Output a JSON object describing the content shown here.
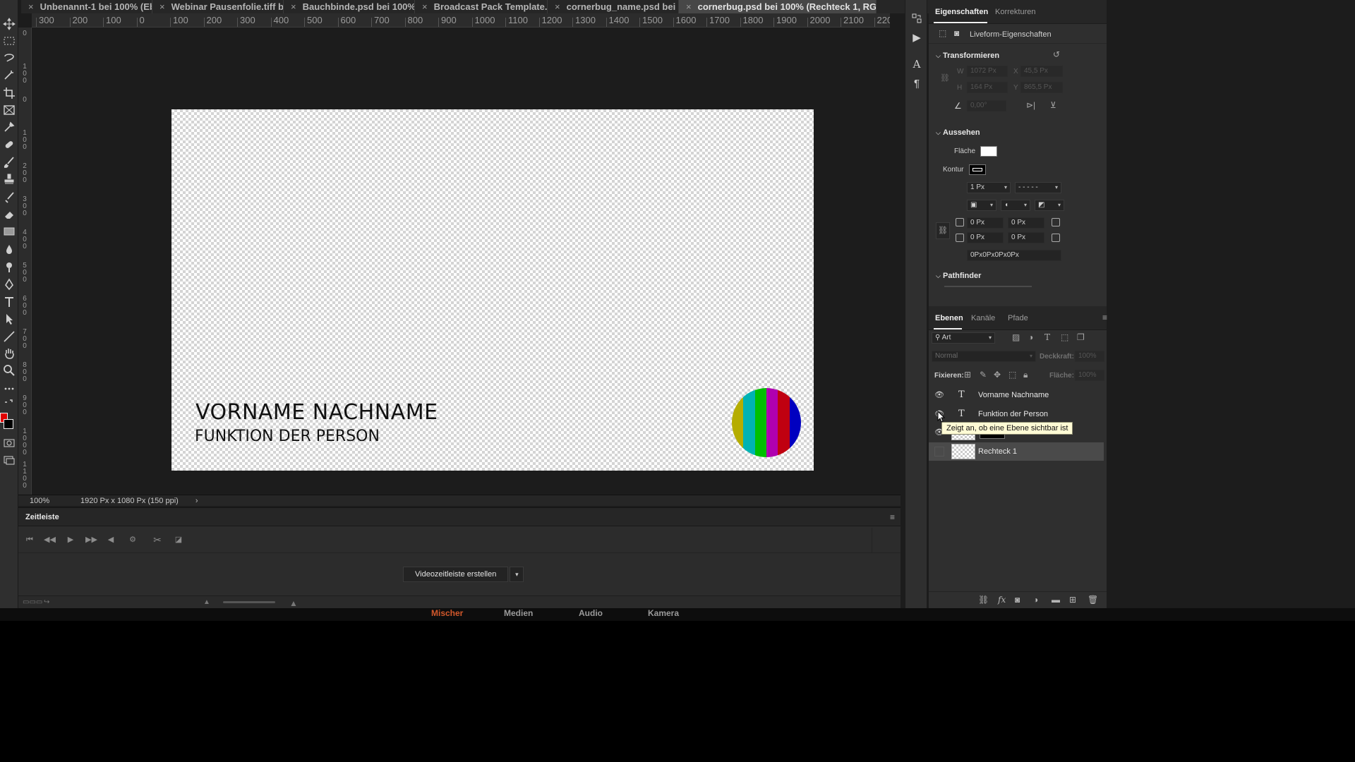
{
  "tabs": [
    {
      "label": "Unbenannt-1 bei 100% (Eb...",
      "active": false
    },
    {
      "label": "Webinar Pausenfolie.tiff bei...",
      "active": false
    },
    {
      "label": "Bauchbinde.psd bei 100% (...",
      "active": false
    },
    {
      "label": "Broadcast Pack Template.psd",
      "active": false
    },
    {
      "label": "cornerbug_name.psd bei 1...",
      "active": false
    },
    {
      "label": "cornerbug.psd bei 100% (Rechteck 1, RGB/8) *",
      "active": true
    }
  ],
  "tab_close_glyph": "×",
  "ruler": {
    "h_labels": [
      "300",
      "200",
      "100",
      "0",
      "100",
      "200",
      "300",
      "400",
      "500",
      "600",
      "700",
      "800",
      "900",
      "1000",
      "1100",
      "1200",
      "1300",
      "1400",
      "1500",
      "1600",
      "1700",
      "1800",
      "1900",
      "2000",
      "2100",
      "220"
    ],
    "v_labels": [
      "0",
      "100",
      "0",
      "100",
      "200",
      "300",
      "400",
      "500",
      "600",
      "700",
      "800",
      "900",
      "1000",
      "1100",
      "1200"
    ]
  },
  "canvas": {
    "name_text": "VORNAME NACHNAME",
    "function_text": "FUNKTION DER PERSON",
    "cornerbug_colors": [
      "#b5ad00",
      "#00b3b3",
      "#00c000",
      "#b000b0",
      "#c00010",
      "#0000c0"
    ]
  },
  "status": {
    "zoom": "100%",
    "doc_size": "1920 Px x 1080 Px (150 ppi)",
    "arrow": "›"
  },
  "timeline": {
    "title": "Zeitleiste",
    "menu_icon": "≡",
    "create_button": "Videozeitleiste erstellen",
    "dropdown": "▾"
  },
  "workspaces": [
    {
      "label": "Mischer",
      "active": true
    },
    {
      "label": "Medien",
      "active": false
    },
    {
      "label": "Audio",
      "active": false
    },
    {
      "label": "Kamera",
      "active": false
    }
  ],
  "properties": {
    "tabs": [
      "Eigenschaften",
      "Korrekturen"
    ],
    "subtitle": "Liveform-Eigenschaften",
    "transform": {
      "title": "Transformieren",
      "w_label": "W",
      "w_value": "1072 Px",
      "x_label": "X",
      "x_value": "45,5 Px",
      "h_label": "H",
      "h_value": "164 Px",
      "y_label": "Y",
      "y_value": "865,5 Px",
      "angle": "0,00°"
    },
    "appearance": {
      "title": "Aussehen",
      "fill_label": "Fläche",
      "fill_color": "#ffffff",
      "stroke_label": "Kontur",
      "stroke_width": "1 Px",
      "stroke_style": "- - - - -",
      "corners": [
        "0 Px",
        "0 Px",
        "0 Px",
        "0 Px"
      ],
      "corner_summary": "0Px0Px0Px0Px"
    },
    "pathfinder": {
      "title": "Pathfinder"
    }
  },
  "layers": {
    "tabs": [
      "Ebenen",
      "Kanäle",
      "Pfade"
    ],
    "filter": "Art",
    "blend_mode": "Normal",
    "opacity_label": "Deckkraft:",
    "opacity_value": "100%",
    "lock_label": "Fixieren:",
    "fill_label": "Fläche:",
    "fill_value": "100%",
    "rows": [
      {
        "name": "Vorname Nachname",
        "type": "text"
      },
      {
        "name": "Funktion der Person",
        "type": "text"
      },
      {
        "name": "Cololo",
        "type": "shape"
      },
      {
        "name": "Rechteck 1",
        "type": "shape"
      }
    ],
    "tooltip": "Zeigt an, ob eine Ebene sichtbar ist"
  }
}
